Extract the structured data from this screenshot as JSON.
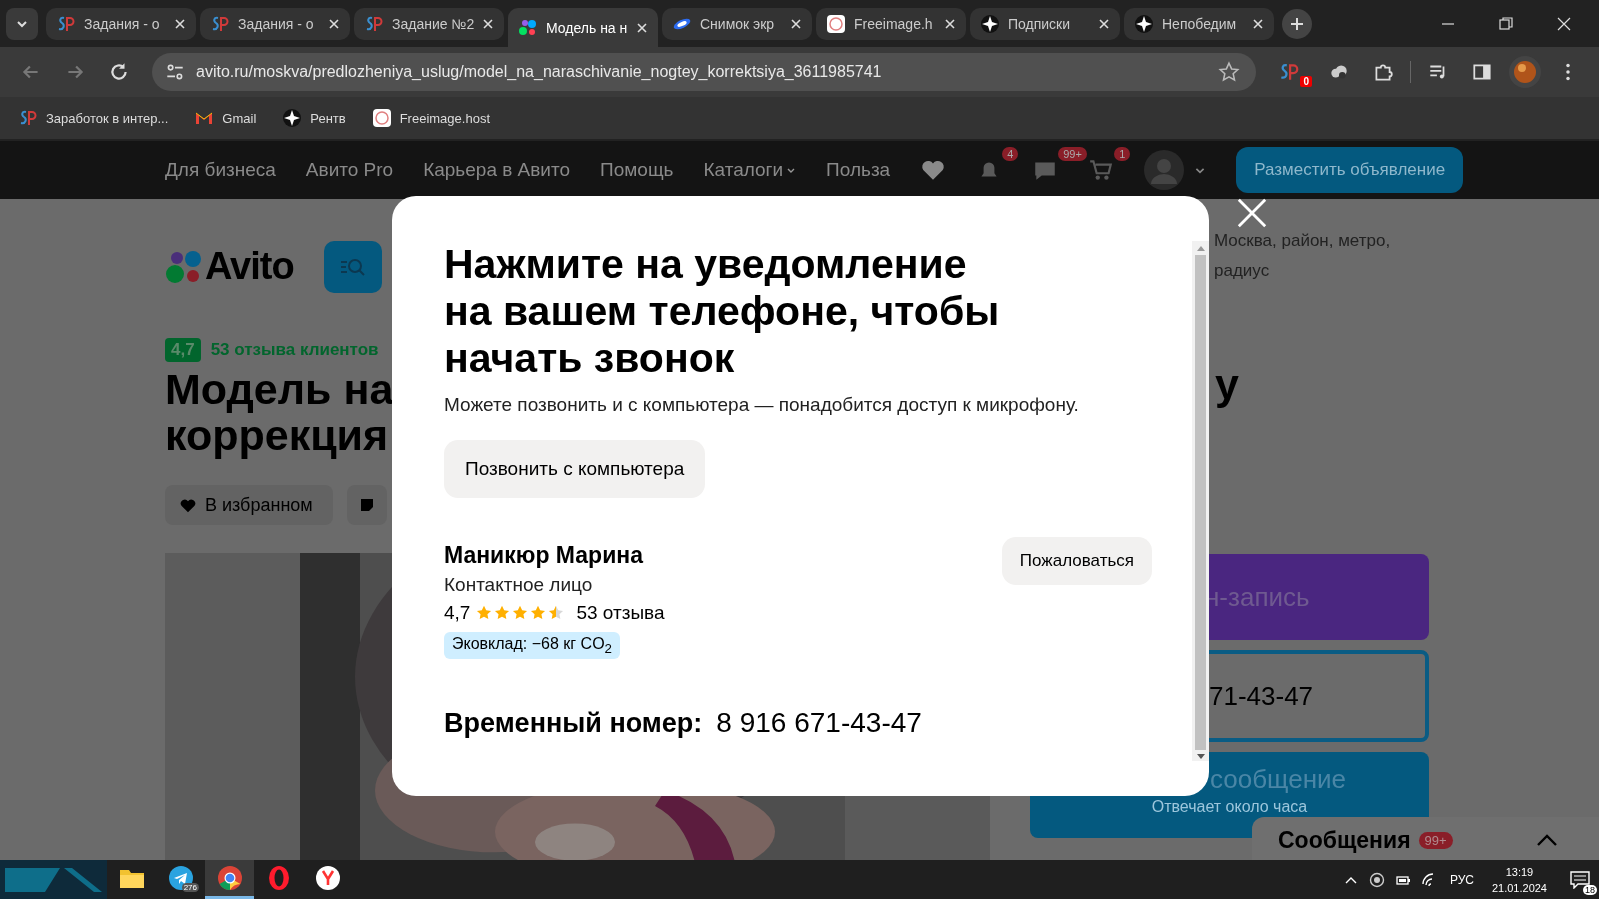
{
  "browser": {
    "tabs": [
      {
        "title": "Задания - о",
        "selected": false
      },
      {
        "title": "Задания - о",
        "selected": false
      },
      {
        "title": "Задание №2",
        "selected": false
      },
      {
        "title": "Модель на н",
        "selected": true
      },
      {
        "title": "Снимок экр",
        "selected": false
      },
      {
        "title": "Freeimage.h",
        "selected": false
      },
      {
        "title": "Подписки",
        "selected": false
      },
      {
        "title": "Непобедим",
        "selected": false
      }
    ],
    "url": "avito.ru/moskva/predlozheniya_uslug/model_na_naraschivanie_nogtey_korrektsiya_3611985741",
    "extension_badge": "0",
    "bookmarks": [
      {
        "title": "Заработок в интер..."
      },
      {
        "title": "Gmail"
      },
      {
        "title": "Рентв"
      },
      {
        "title": "Freeimage.host"
      }
    ]
  },
  "site": {
    "nav": [
      "Для бизнеса",
      "Авито Pro",
      "Карьера в Авито",
      "Помощь",
      "Каталоги",
      "Польза"
    ],
    "badges": {
      "notifications": "4",
      "messages": "99+",
      "cart": "1"
    },
    "post_button": "Разместить объявление",
    "logo": "Avito",
    "location": [
      "Москва, район, метро,",
      "радиус"
    ],
    "rating": "4,7",
    "reviews": "53 отзыва клиентов",
    "title_lines": [
      "Модель на",
      "коррекция"
    ],
    "title_tail": "у",
    "favorite_button": "В избранном",
    "booking_button": "н-запись",
    "phone_button": "71-43-47",
    "message_button": "сообщение",
    "message_hint": "Отвечает около часа",
    "messages_panel": {
      "title": "Сообщения",
      "count": "99+"
    }
  },
  "modal": {
    "title": "Нажмите на уведомление на вашем телефоне, чтобы начать звонок",
    "subtitle": "Можете позвонить и с компьютера — понадобится доступ к микрофону.",
    "call_button": "Позвонить с компьютера",
    "seller": {
      "name": "Маникюр Марина",
      "role": "Контактное лицо",
      "rating": "4,7",
      "stars": 4.5,
      "reviews": "53 отзыва",
      "eco": "Эковклад: −68 кг CO$_{2}$"
    },
    "report_button": "Пожаловаться",
    "temp_label": "Временный номер:",
    "temp_number": "8 916 671-43-47"
  },
  "taskbar": {
    "apps": [
      {
        "kind": "folder",
        "active": false
      },
      {
        "kind": "telegram",
        "active": false,
        "badge": "276"
      },
      {
        "kind": "chrome",
        "active": true
      },
      {
        "kind": "opera",
        "active": false
      },
      {
        "kind": "yandex",
        "active": false
      }
    ],
    "language": "РУС",
    "time": "13:19",
    "date": "21.01.2024",
    "notifications": "18"
  }
}
